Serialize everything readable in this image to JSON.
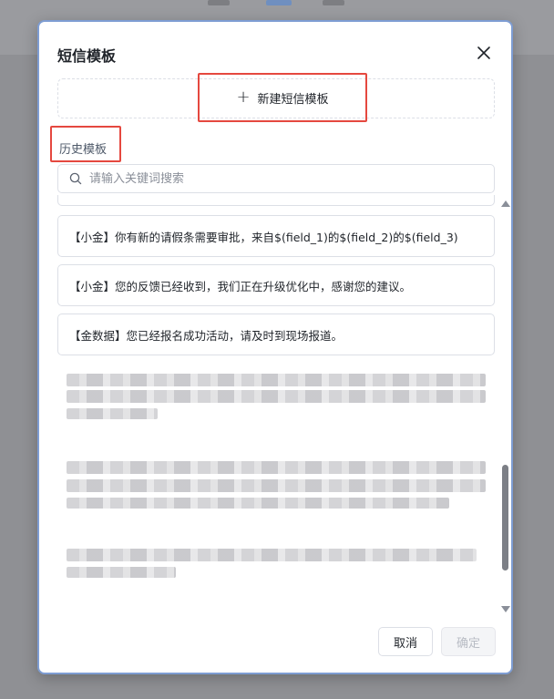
{
  "dialog": {
    "title": "短信模板",
    "new_template_label": "新建短信模板",
    "history_label": "历史模板",
    "search": {
      "placeholder": "请输入关键词搜索",
      "value": ""
    },
    "templates": [
      "【小金】你有新的请假条需要审批，来自$(field_1)的$(field_2)的$(field_3)",
      "【小金】您的反馈已经收到，我们正在升级优化中，感谢您的建议。",
      "【金数据】您已经报名成功活动，请及时到现场报道。"
    ],
    "scrollbar": {
      "position_fraction": 0.78
    },
    "footer": {
      "cancel_label": "取消",
      "confirm_label": "确定",
      "confirm_disabled": true
    }
  },
  "icons": {
    "close": "close-icon",
    "plus": "plus-icon",
    "search": "search-icon"
  },
  "colors": {
    "highlight": "#e5483f",
    "modal_border": "#7e9dd3",
    "overlay": "#8f9094"
  }
}
